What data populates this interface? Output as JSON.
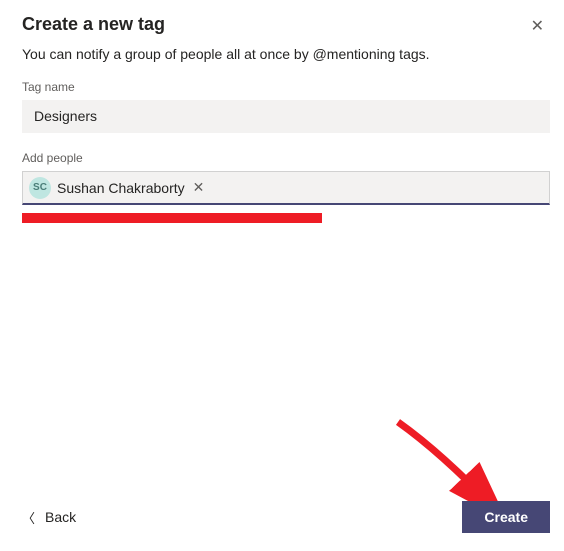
{
  "dialog": {
    "title": "Create a new tag",
    "subtitle": "You can notify a group of people all at once by @mentioning tags."
  },
  "fields": {
    "tag_name": {
      "label": "Tag name",
      "value": "Designers"
    },
    "add_people": {
      "label": "Add people",
      "selected": [
        {
          "initials": "SC",
          "name": "Sushan Chakraborty"
        }
      ]
    }
  },
  "footer": {
    "back_label": "Back",
    "create_label": "Create"
  },
  "annotation": {
    "redaction_present": true,
    "arrow_present": true
  }
}
